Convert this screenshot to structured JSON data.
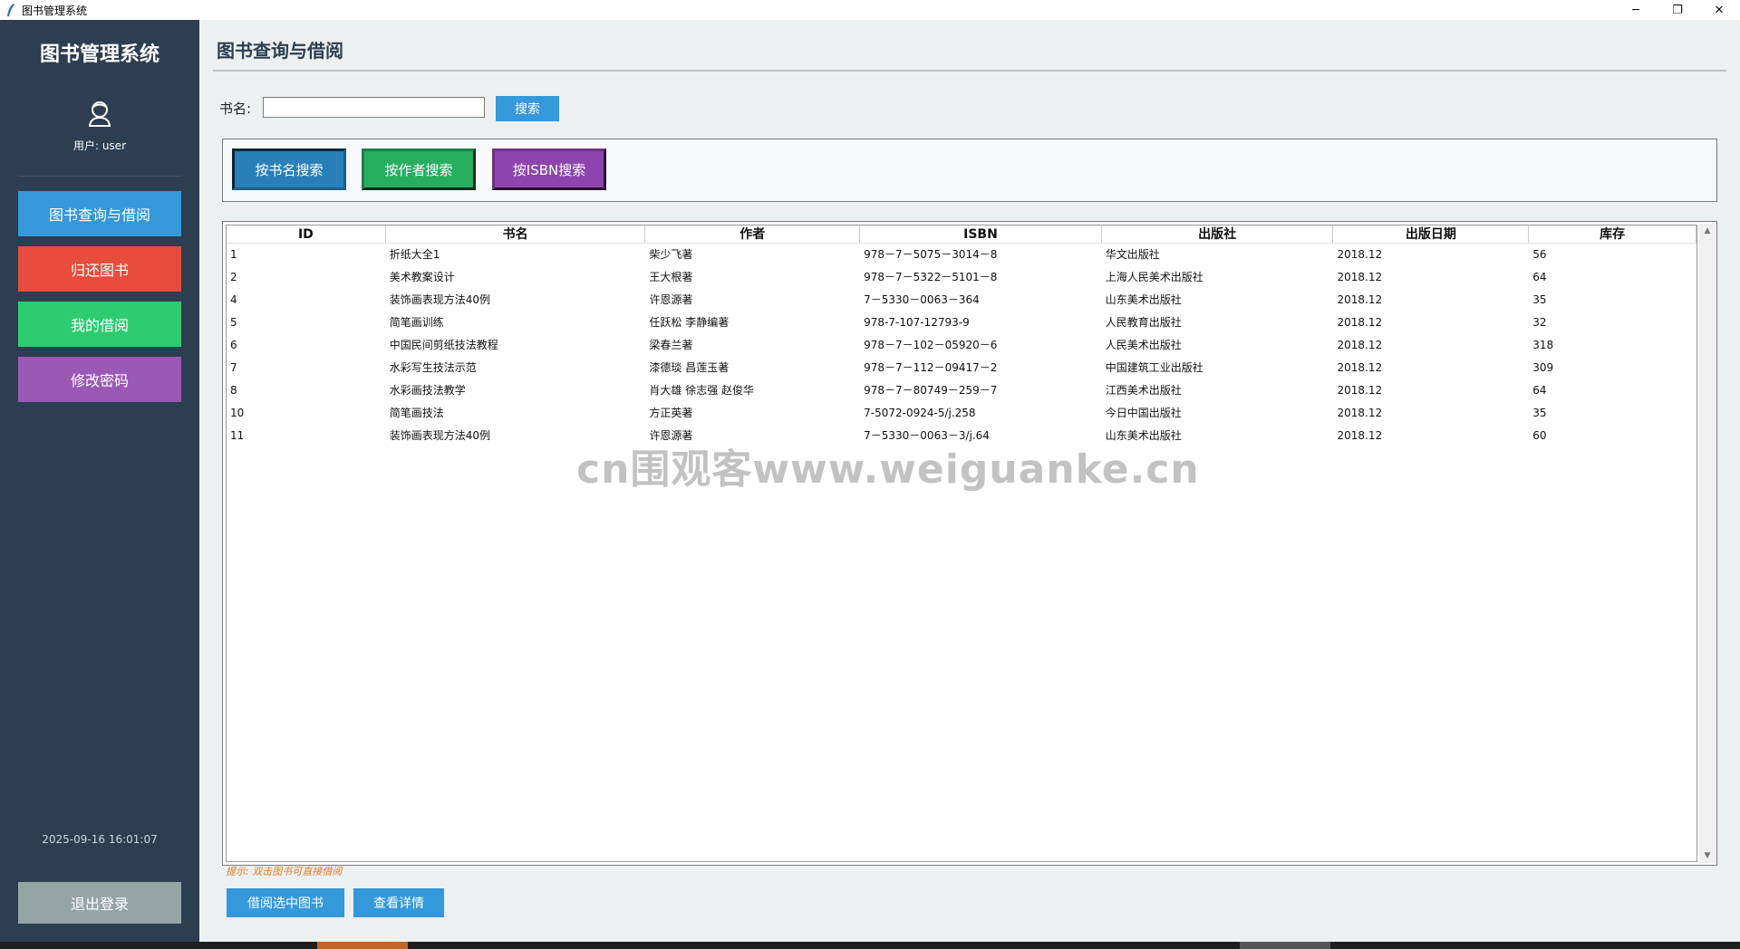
{
  "window": {
    "title": "图书管理系统",
    "controls": {
      "minimize": "─",
      "restore": "❐",
      "close": "✕"
    }
  },
  "sidebar": {
    "app_title": "图书管理系统",
    "user_label": "用户: user",
    "nav": [
      {
        "label": "图书查询与借阅",
        "color": "#3498db"
      },
      {
        "label": "归还图书",
        "color": "#e74c3c"
      },
      {
        "label": "我的借阅",
        "color": "#2ecc71"
      },
      {
        "label": "修改密码",
        "color": "#9b59b6"
      }
    ],
    "datetime": "2025-09-16 16:01:07",
    "logout": "退出登录"
  },
  "main": {
    "page_title": "图书查询与借阅",
    "search": {
      "label": "书名:",
      "value": "",
      "button": "搜索"
    },
    "modes": [
      "按书名搜索",
      "按作者搜索",
      "按ISBN搜索"
    ],
    "table": {
      "columns": [
        "ID",
        "书名",
        "作者",
        "ISBN",
        "出版社",
        "出版日期",
        "库存"
      ],
      "rows": [
        [
          "1",
          "折纸大全1",
          "柴少飞著",
          "978－7－5075－3014－8",
          "华文出版社",
          "2018.12",
          "56"
        ],
        [
          "2",
          "美术教案设计",
          "王大根著",
          "978－7－5322－5101－8",
          "上海人民美术出版社",
          "2018.12",
          "64"
        ],
        [
          "4",
          "装饰画表现方法40例",
          "许恩源著",
          "7－5330－0063－364",
          "山东美术出版社",
          "2018.12",
          "35"
        ],
        [
          "5",
          "简笔画训练",
          "任跃松 李静编著",
          "978-7-107-12793-9",
          "人民教育出版社",
          "2018.12",
          "32"
        ],
        [
          "6",
          "中国民间剪纸技法教程",
          "梁春兰著",
          "978－7－102－05920－6",
          "人民美术出版社",
          "2018.12",
          "318"
        ],
        [
          "7",
          "水彩写生技法示范",
          "漆德琰 昌莲玉著",
          "978－7－112－09417－2",
          "中国建筑工业出版社",
          "2018.12",
          "309"
        ],
        [
          "8",
          "水彩画技法教学",
          "肖大雄 徐志强 赵俊华",
          "978－7－80749－259－7",
          "江西美术出版社",
          "2018.12",
          "64"
        ],
        [
          "10",
          "简笔画技法",
          "方正英著",
          "7-5072-0924-5/j.258",
          "今日中国出版社",
          "2018.12",
          "35"
        ],
        [
          "11",
          "装饰画表现方法40例",
          "许恩源著",
          "7－5330－0063－3/j.64",
          "山东美术出版社",
          "2018.12",
          "60"
        ]
      ]
    },
    "hint": "提示: 双击图书可直接借阅",
    "actions": [
      "借阅选中图书",
      "查看详情"
    ]
  },
  "watermark": "cn围观客www.weiguanke.cn"
}
